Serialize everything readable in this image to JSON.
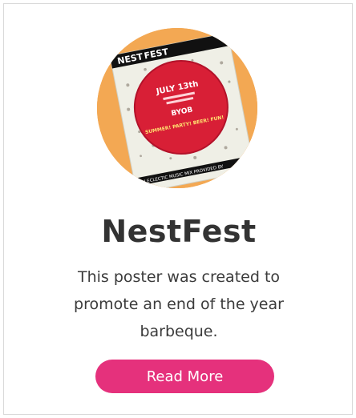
{
  "card": {
    "title": "NestFest",
    "description": "This poster was created to promote an end of the year barbeque.",
    "button_label": "Read More"
  },
  "poster": {
    "brand_prefix": "NEST",
    "brand_suffix": "FEST",
    "date": "JULY 13th",
    "byob": "BYOB",
    "tagline": "SUMMER! PARTY! BEER! FUN!",
    "footer": "AN ECLECTIC MUSIC MIX PROVIDED BY"
  },
  "colors": {
    "accent": "#e5317c",
    "poster_red": "#d81f36",
    "title": "#333333",
    "avatar_bg": "#f5a84a"
  }
}
